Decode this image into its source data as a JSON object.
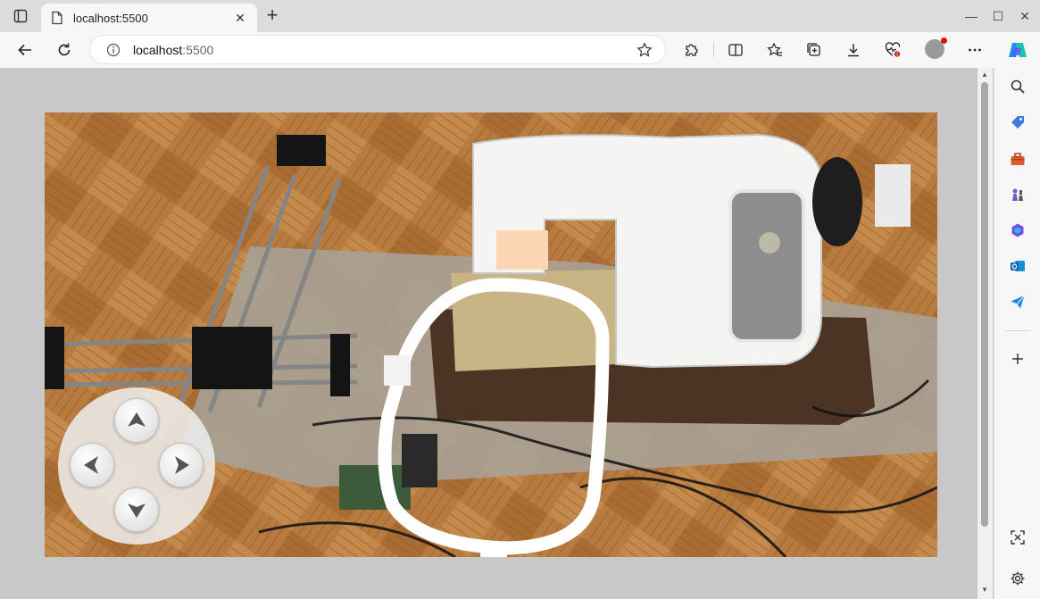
{
  "browser": {
    "tab_title": "localhost:5500",
    "url_host": "localhost",
    "url_port": ":5500"
  },
  "icons": {
    "tab_actions": "tab-actions-icon",
    "favicon": "page-icon",
    "back": "back-arrow-icon",
    "reload": "reload-icon",
    "info": "info-icon",
    "favorite": "star-icon",
    "extensions": "puzzle-icon",
    "split": "split-screen-icon",
    "favorites": "favorites-icon",
    "collections": "collections-icon",
    "downloads": "download-icon",
    "performance": "heart-pulse-icon",
    "profile": "avatar",
    "more": "more-icon",
    "copilot": "copilot-icon",
    "sidebar_search": "search-icon",
    "sidebar_shopping": "tag-icon",
    "sidebar_tools": "toolbox-icon",
    "sidebar_games": "chess-icon",
    "sidebar_office": "office-icon",
    "sidebar_outlook": "outlook-icon",
    "sidebar_send": "send-icon",
    "sidebar_add": "plus-icon",
    "sidebar_screenshot": "screenshot-icon",
    "sidebar_settings": "gear-icon"
  },
  "controls": {
    "dpad": [
      "up",
      "left",
      "right",
      "down"
    ]
  },
  "colors": {
    "hoop": "#ffffff",
    "needle_marker": "#fcd6b4",
    "floor": "#b57a3e"
  }
}
